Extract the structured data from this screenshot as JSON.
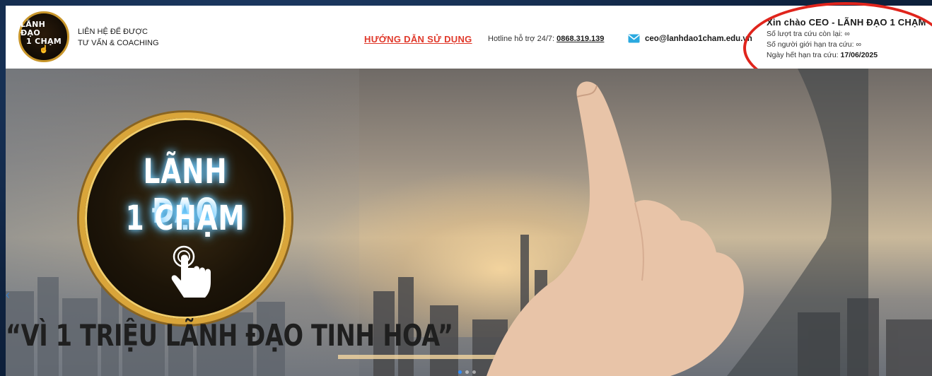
{
  "header": {
    "logo": {
      "line1": "LÃNH ĐẠO",
      "line2": "1 CHẠM"
    },
    "contact_line1": "LIÊN HỆ ĐỂ ĐƯỢC",
    "contact_line2": "TƯ VẤN & COACHING",
    "guide_link": "HƯỚNG DẪN SỬ DỤNG",
    "hotline_label": "Hotline hỗ trợ 24/7:",
    "hotline_number": "0868.319.139",
    "mail_icon": "mail-icon",
    "email": "ceo@lanhdao1cham.edu.vn"
  },
  "account": {
    "greeting": "Xin chào CEO - LÃNH ĐẠO 1 CHẠM",
    "lookups_left_label": "Số lượt tra cứu còn lại:",
    "lookups_left_value": "∞",
    "user_limit_label": "Số người giới hạn tra cứu:",
    "user_limit_value": "∞",
    "expiry_label": "Ngày hết hạn tra cứu:",
    "expiry_value": "17/06/2025"
  },
  "banner": {
    "emblem_line1": "LÃNH ĐẠO",
    "emblem_line2": "1 CHẠM",
    "slogan": "“VÌ 1 TRIỆU LÃNH ĐẠO TINH HOA”",
    "slide_count": 3,
    "active_slide": 1
  },
  "colors": {
    "accent_red": "#e0392b",
    "gold": "#d9a53a",
    "highlight_ring": "#e0241c",
    "slide_dot_active": "#2f8dff"
  }
}
